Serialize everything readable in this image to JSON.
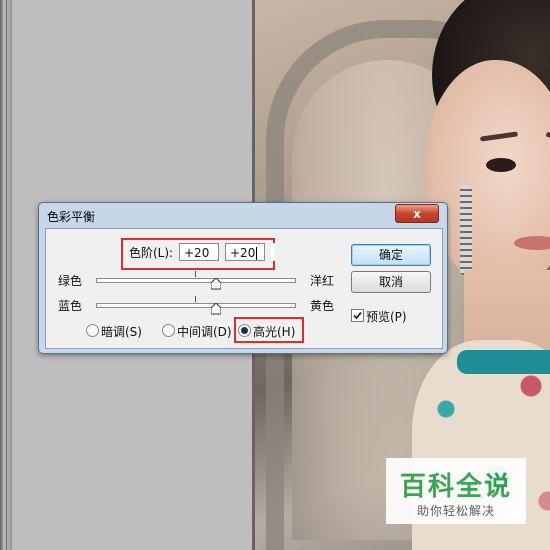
{
  "dialog": {
    "title": "色彩平衡",
    "close_glyph": "x",
    "levels": {
      "label": "色阶(L):",
      "values": [
        "+20",
        "+20",
        ""
      ]
    },
    "sliders": [
      {
        "left_label": "绿色",
        "right_label": "洋红",
        "value_fraction": 0.6
      },
      {
        "left_label": "蓝色",
        "right_label": "黄色",
        "value_fraction": 0.6
      }
    ],
    "tone": {
      "options": [
        "暗调(S)",
        "中间调(D)",
        "高光(H)"
      ],
      "selected": "高光(H)"
    },
    "buttons": {
      "ok": "确定",
      "cancel": "取消"
    },
    "preview": {
      "label": "预览(P)",
      "checked": true
    }
  },
  "watermark": {
    "title": "百科全说",
    "subtitle": "助你轻松解决",
    "color": "#2fa24a"
  },
  "colors": {
    "annotation_red": "#d8302c",
    "dialog_frame": "#c7d7e8",
    "workspace_gray": "#b7b7b7"
  }
}
